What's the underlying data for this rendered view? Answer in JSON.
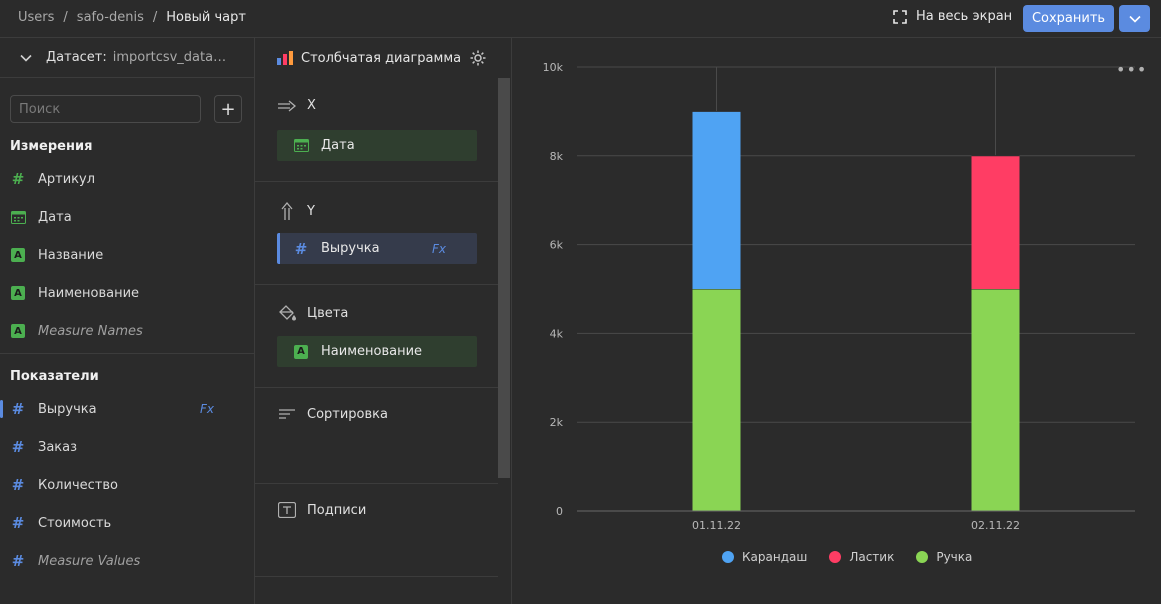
{
  "breadcrumbs": [
    "Users",
    "safo-denis"
  ],
  "breadcrumb_current": "Новый чарт",
  "breadcrumb_sep": "/",
  "header": {
    "fullscreen_label": "На весь экран",
    "save_label": "Сохранить"
  },
  "dataset": {
    "label": "Датасет:",
    "name": "importcsv_data…"
  },
  "search": {
    "placeholder": "Поиск",
    "add": "+"
  },
  "dimensions": {
    "title": "Измерения",
    "items": [
      {
        "label": "Артикул",
        "icon": "hash-green"
      },
      {
        "label": "Дата",
        "icon": "calendar"
      },
      {
        "label": "Название",
        "icon": "abc"
      },
      {
        "label": "Наименование",
        "icon": "abc"
      },
      {
        "label": "Measure Names",
        "icon": "abc"
      }
    ]
  },
  "measures": {
    "title": "Показатели",
    "items": [
      {
        "label": "Выручка",
        "icon": "hash",
        "formula": "Fx"
      },
      {
        "label": "Заказ",
        "icon": "hash"
      },
      {
        "label": "Количество",
        "icon": "hash"
      },
      {
        "label": "Стоимость",
        "icon": "hash"
      },
      {
        "label": "Measure Values",
        "icon": "hash"
      }
    ]
  },
  "config": {
    "chart_type": "Столбчатая диаграмма",
    "x_title": "X",
    "x_field": "Дата",
    "y_title": "Y",
    "y_field": "Выручка",
    "y_formula": "Fx",
    "colors_title": "Цвета",
    "colors_field": "Наименование",
    "sort_title": "Сортировка",
    "labels_title": "Подписи"
  },
  "colors": {
    "accent": "#5b8be0",
    "pencil": "#4fa3f3",
    "eraser": "#ff3d64",
    "pen": "#8ad554"
  },
  "chart_data": {
    "type": "bar",
    "stacked": true,
    "categories": [
      "01.11.22",
      "02.11.22"
    ],
    "series": [
      {
        "name": "Ручка",
        "values": [
          5000,
          5000
        ],
        "color": "#8ad554"
      },
      {
        "name": "Ластик",
        "values": [
          0,
          3000
        ],
        "color": "#ff3d64"
      },
      {
        "name": "Карандаш",
        "values": [
          4000,
          0
        ],
        "color": "#4fa3f3"
      }
    ],
    "y_ticks": [
      0,
      2000,
      4000,
      6000,
      8000,
      10000
    ],
    "y_tick_labels": [
      "0",
      "2k",
      "4k",
      "6k",
      "8k",
      "10k"
    ],
    "ylim": [
      0,
      10000
    ],
    "grid": true,
    "legend_position": "bottom",
    "legend": [
      "Карандаш",
      "Ластик",
      "Ручка"
    ]
  },
  "more_label": "•••"
}
